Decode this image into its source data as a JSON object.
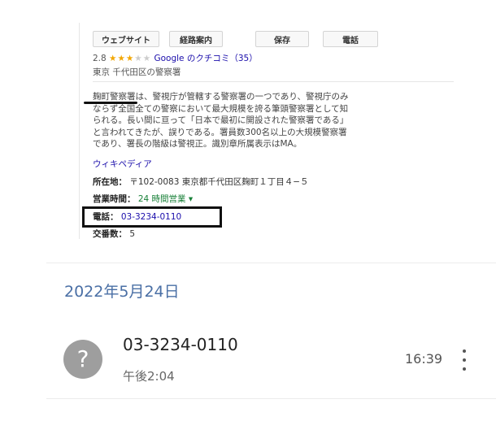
{
  "panel": {
    "buttons": {
      "website": "ウェブサイト",
      "directions": "経路案内",
      "save": "保存",
      "call": "電話"
    },
    "rating": {
      "score": "2.8",
      "stars_on": "★★★",
      "stars_off": "★★",
      "reviews": "Google のクチコミ（35）"
    },
    "subtitle": "東京 千代田区の警察署",
    "description": "麹町警察署は、警視庁が管轄する警察署の一つであり、警視庁のみ\nならず全国全ての警察において最大規模を誇る筆頭警察署として知\nられる。長い間に亘って「日本で最初に開設された警察署である」\nと言われてきたが、誤りである。署員数300名以上の大規模警察署\nであり、署長の階級は警視正。識別章所属表示はMA。",
    "wiki_link": "ウィキペディア",
    "address": {
      "label": "所在地：",
      "value": "〒102-0083 東京都千代田区麹町１丁目４−５"
    },
    "hours": {
      "label": "営業時間：",
      "value": "24 時間営業 ▾"
    },
    "phone": {
      "label": "電話：",
      "value": "03-3234-0110"
    },
    "precinct": {
      "label": "交番数：",
      "value": "5"
    }
  },
  "calllog": {
    "date_header": "2022年5月24日",
    "entry": {
      "avatar": "?",
      "number": "03-3234-0110",
      "subtext": "午後2:04",
      "time": "16:39"
    }
  },
  "colors": {
    "link": "#1a0dab",
    "star": "#f2a600",
    "open_green": "#188038",
    "date_header": "#4a6fa5",
    "avatar": "#9e9e9e"
  },
  "icons": {
    "avatar": "question-mark-avatar-icon",
    "more": "more-vert-icon"
  }
}
